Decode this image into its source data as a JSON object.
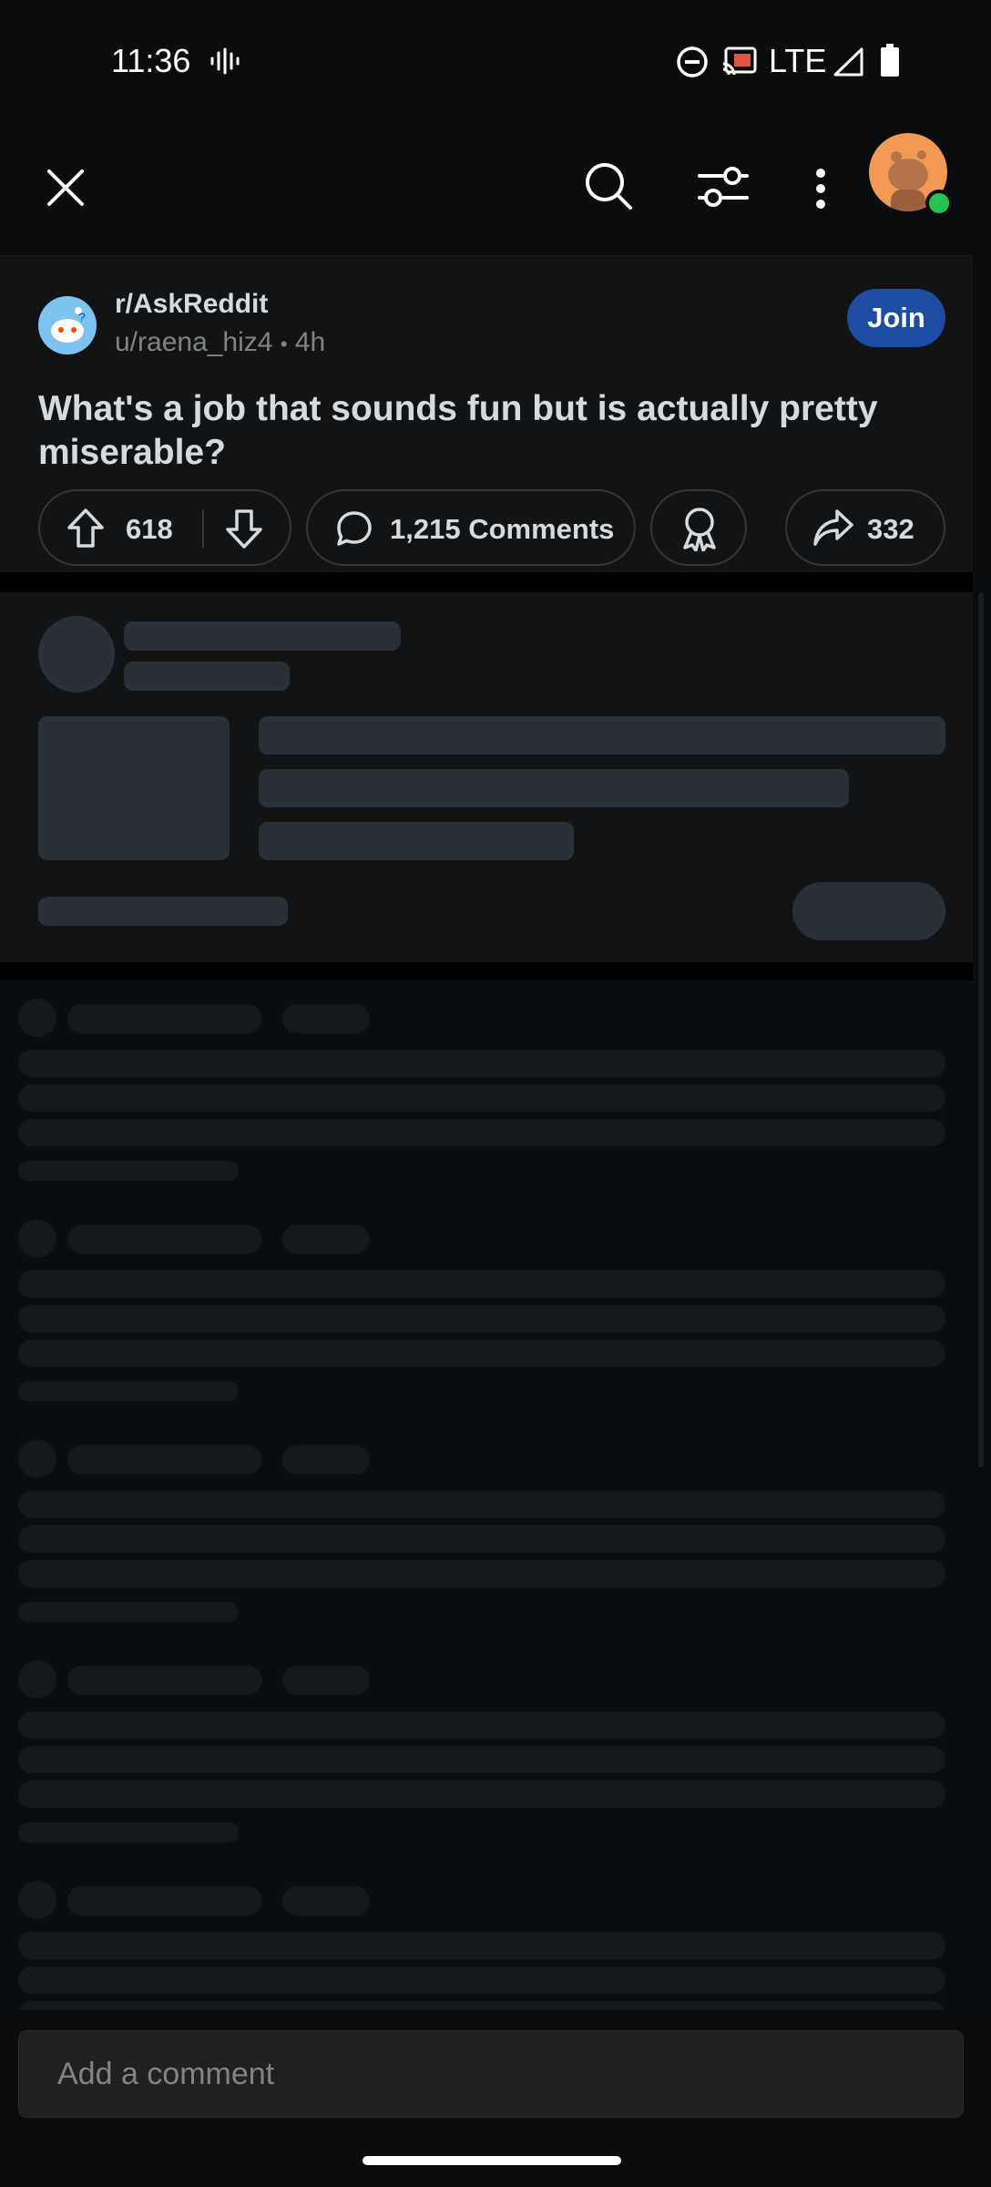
{
  "status_bar": {
    "time": "11:36",
    "network": "LTE"
  },
  "toolbar": {
    "icons": [
      "close-icon",
      "search-icon",
      "sort-filter-icon",
      "more-vertical-icon",
      "avatar"
    ]
  },
  "post": {
    "subreddit": "r/AskReddit",
    "author": "u/raena_hiz4",
    "age": "4h",
    "separator": "•",
    "join_label": "Join",
    "title": "What's a job that sounds fun but is actually pretty miserable?",
    "upvotes": "618",
    "comments_label": "1,215 Comments",
    "shares": "332"
  },
  "comment_box": {
    "placeholder": "Add a comment"
  },
  "colors": {
    "join_bg": "#1d4ca3",
    "online_dot": "#27c154",
    "avatar_bg": "#f29a55"
  }
}
